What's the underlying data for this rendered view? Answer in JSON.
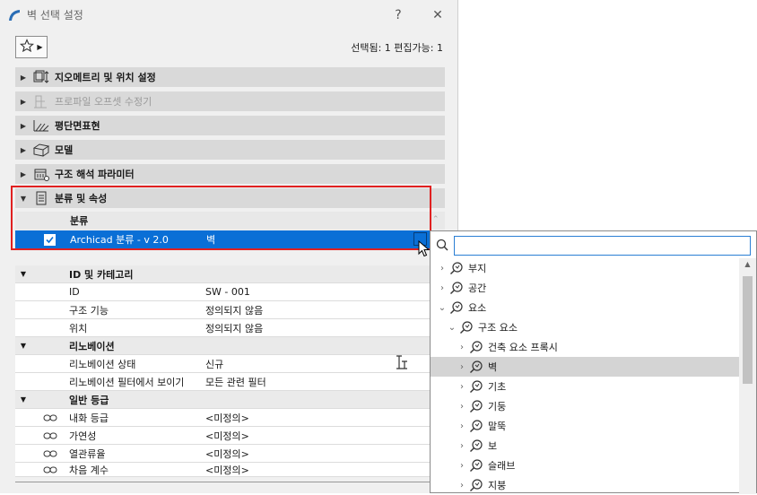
{
  "dialog": {
    "title": "벽 선택 설정",
    "help_label": "?",
    "close_label": "✕",
    "selection_info": "선택됨: 1 편집가능: 1"
  },
  "panels": [
    {
      "label": "지오메트리 및 위치 설정",
      "icon": "geometry-icon",
      "disabled": false
    },
    {
      "label": "프로파일 오프셋 수정기",
      "icon": "profile-icon",
      "disabled": true
    },
    {
      "label": "평단면표현",
      "icon": "floorplan-icon",
      "disabled": false
    },
    {
      "label": "모델",
      "icon": "model-icon",
      "disabled": false
    },
    {
      "label": "구조 해석 파라미터",
      "icon": "structural-icon",
      "disabled": false
    },
    {
      "label": "분류 및 속성",
      "icon": "classification-icon",
      "disabled": false
    }
  ],
  "classification": {
    "header": "분류",
    "row": {
      "system": "Archicad 분류 - v 2.0",
      "value": "벽",
      "checked": true
    }
  },
  "properties": [
    {
      "type": "group",
      "label": "ID 및 카테고리"
    },
    {
      "type": "row",
      "name": "ID",
      "value": "SW - 001"
    },
    {
      "type": "row",
      "name": "구조 기능",
      "value": "정의되지 않음"
    },
    {
      "type": "row",
      "name": "위치",
      "value": "정의되지 않음"
    },
    {
      "type": "group",
      "label": "리노베이션"
    },
    {
      "type": "row",
      "name": "리노베이션 상태",
      "value": "신규"
    },
    {
      "type": "row",
      "name": "리노베이션 필터에서 보이기",
      "value": "모든 관련 필터"
    },
    {
      "type": "group",
      "label": "일반 등급"
    },
    {
      "type": "linkrow",
      "name": "내화 등급",
      "value": "<미정의>"
    },
    {
      "type": "linkrow",
      "name": "가연성",
      "value": "<미정의>"
    },
    {
      "type": "linkrow",
      "name": "열관류율",
      "value": "<미정의>"
    },
    {
      "type": "linkrow",
      "name": "차음 계수",
      "value": "<미정의>"
    }
  ],
  "popup": {
    "search_value": "",
    "tree": [
      {
        "label": "부지",
        "level": 0,
        "chevron": "›",
        "selected": false
      },
      {
        "label": "공간",
        "level": 0,
        "chevron": "›",
        "selected": false
      },
      {
        "label": "요소",
        "level": 0,
        "chevron": "⌄",
        "selected": false
      },
      {
        "label": "구조 요소",
        "level": 1,
        "chevron": "⌄",
        "selected": false
      },
      {
        "label": "건축 요소 프록시",
        "level": 2,
        "chevron": "›",
        "selected": false
      },
      {
        "label": "벽",
        "level": 2,
        "chevron": "›",
        "selected": true
      },
      {
        "label": "기초",
        "level": 2,
        "chevron": "›",
        "selected": false
      },
      {
        "label": "기둥",
        "level": 2,
        "chevron": "›",
        "selected": false
      },
      {
        "label": "말뚝",
        "level": 2,
        "chevron": "›",
        "selected": false
      },
      {
        "label": "보",
        "level": 2,
        "chevron": "›",
        "selected": false
      },
      {
        "label": "슬래브",
        "level": 2,
        "chevron": "›",
        "selected": false
      },
      {
        "label": "지붕",
        "level": 2,
        "chevron": "›",
        "selected": false
      }
    ]
  },
  "colors": {
    "accent": "#0a6fd6",
    "highlight_border": "#e02020"
  }
}
